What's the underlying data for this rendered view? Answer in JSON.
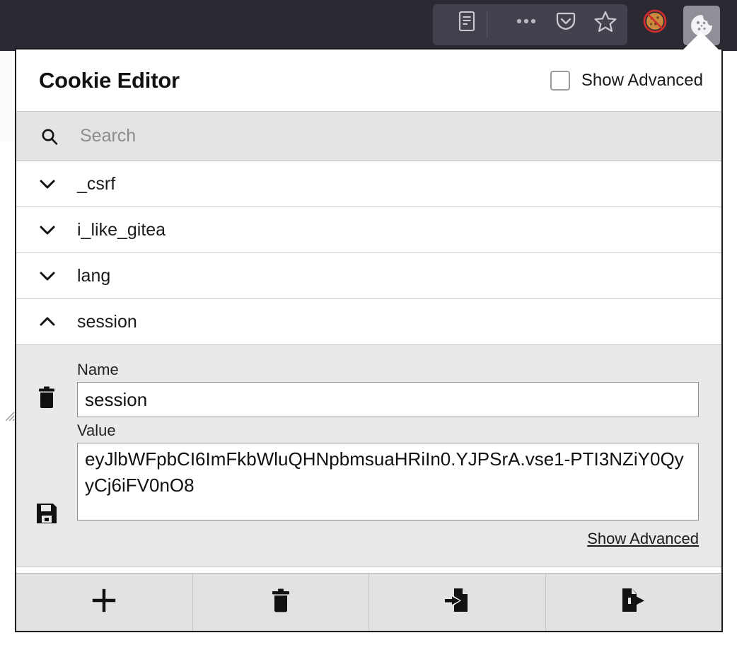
{
  "browser": {
    "toolbar_icons": [
      {
        "name": "reader-view-icon",
        "label": "Reader View"
      },
      {
        "name": "page-actions-icon",
        "label": "Page actions"
      },
      {
        "name": "pocket-icon",
        "label": "Save to Pocket"
      },
      {
        "name": "bookmark-star-icon",
        "label": "Bookmark this page"
      },
      {
        "name": "cookie-blocked-icon",
        "label": "Cookie blocking"
      },
      {
        "name": "cookie-editor-icon",
        "label": "Cookie Editor"
      }
    ]
  },
  "popup": {
    "title": "Cookie Editor",
    "show_advanced_label": "Show Advanced",
    "show_advanced_checked": false,
    "search": {
      "placeholder": "Search",
      "value": "",
      "icon": "search-icon"
    },
    "cookies": [
      {
        "name": "_csrf",
        "expanded": false,
        "chevron": "chevron-down-icon"
      },
      {
        "name": "i_like_gitea",
        "expanded": false,
        "chevron": "chevron-down-icon"
      },
      {
        "name": "lang",
        "expanded": false,
        "chevron": "chevron-down-icon"
      },
      {
        "name": "session",
        "expanded": true,
        "chevron": "chevron-up-icon"
      }
    ],
    "expanded_cookie": {
      "name_label": "Name",
      "name_value": "session",
      "value_label": "Value",
      "value_value": "eyJlbWFpbCI6ImFkbWluQHNpbmsuaHRiIn0.YJPSrA.vse1-PTI3NZiY0QyyCj6iFV0nO8",
      "advanced_link": "Show Advanced",
      "delete_icon": "trash-icon",
      "save_icon": "save-floppy-icon"
    },
    "footer_buttons": [
      {
        "name": "add-cookie-button",
        "icon": "plus-icon",
        "label": "Add cookie"
      },
      {
        "name": "delete-all-cookies-button",
        "icon": "trash-icon",
        "label": "Delete all cookies"
      },
      {
        "name": "import-cookies-button",
        "icon": "import-icon",
        "label": "Import cookies"
      },
      {
        "name": "export-cookies-button",
        "icon": "export-icon",
        "label": "Export cookies"
      }
    ]
  },
  "colors": {
    "chrome_bg": "#2b2a33",
    "panel_bg": "#ffffff",
    "search_bg": "#e4e4e4",
    "form_bg": "#e9e9e9",
    "footer_bg": "#e2e2e2",
    "border": "#1c1b22"
  }
}
